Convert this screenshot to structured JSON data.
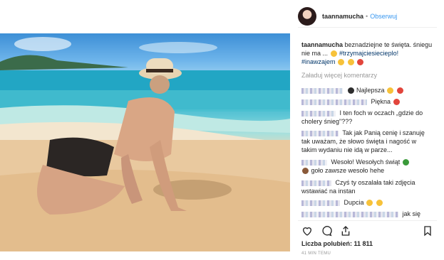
{
  "post": {
    "username": "taannamucha",
    "separator": "•",
    "follow_label": "Obserwuj",
    "caption_user": "taannamucha",
    "caption_text": "beznadziejne te święta. śniegu nie ma ...",
    "caption_tag1": "#trzymajciesiecieplo!",
    "caption_tag2": "#inawzajem",
    "load_more": "Załaduj więcej komentarzy",
    "likes_label": "Liczba polubień: 11 811",
    "time_label": "41 MIN TEMU"
  },
  "comments": [
    {
      "text": "Najlepsza"
    },
    {
      "text": "Piękna"
    },
    {
      "text": "I ten foch w oczach „gdzie do cholery śnieg\"???"
    },
    {
      "text": "Tak jak Panią cenię i szanuję tak uważam, że słowo święta i nagość w takim wydaniu nie idą w parze..."
    },
    {
      "text": "Wesoło! Wesołych świąt",
      "text2": "goło zawsze wesoło hehe"
    },
    {
      "text": "Czyś ty oszalała taki zdjęcia wstawiać na instan"
    },
    {
      "text": "Dupcia"
    },
    {
      "text": "jak się"
    }
  ],
  "colors": {
    "link": "#3897f0",
    "hashtag": "#003569",
    "muted": "#999999",
    "divider": "#efefef"
  },
  "icons": [
    "heart-icon",
    "comment-icon",
    "share-icon",
    "bookmark-icon"
  ]
}
